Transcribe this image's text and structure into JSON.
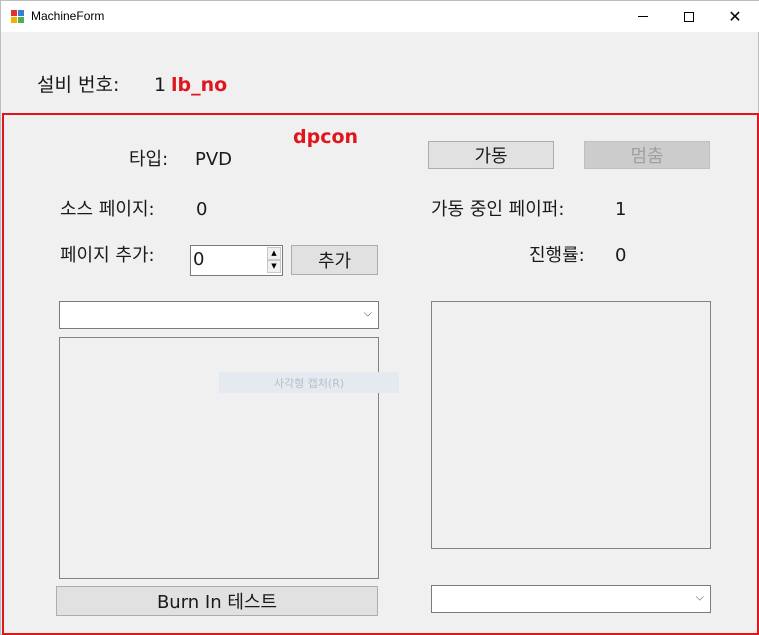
{
  "window": {
    "title": "MachineForm",
    "controls": {
      "minimize": "─",
      "maximize": "□",
      "close": "✕"
    }
  },
  "header": {
    "equipment_label": "설비 번호:",
    "equipment_value": "1",
    "debug_label": "lb_no"
  },
  "panel": {
    "debug_label": "dpcon",
    "type_label": "타입:",
    "type_value": "PVD",
    "source_pages_label": "소스 페이지:",
    "source_pages_value": "0",
    "add_pages_label": "페이지 추가:",
    "add_pages_value": "0",
    "add_button": "추가",
    "run_button": "가동",
    "stop_button": "멈춤",
    "running_wafer_label": "가동 중인 페이퍼:",
    "running_wafer_value": "1",
    "progress_label": "진행률:",
    "progress_value": "0",
    "burn_in_button": "Burn In 테스트",
    "ghost_tooltip": "사각형 캡처(R)"
  },
  "colors": {
    "accent_red": "#e0161f",
    "background": "#f0f0f0"
  }
}
